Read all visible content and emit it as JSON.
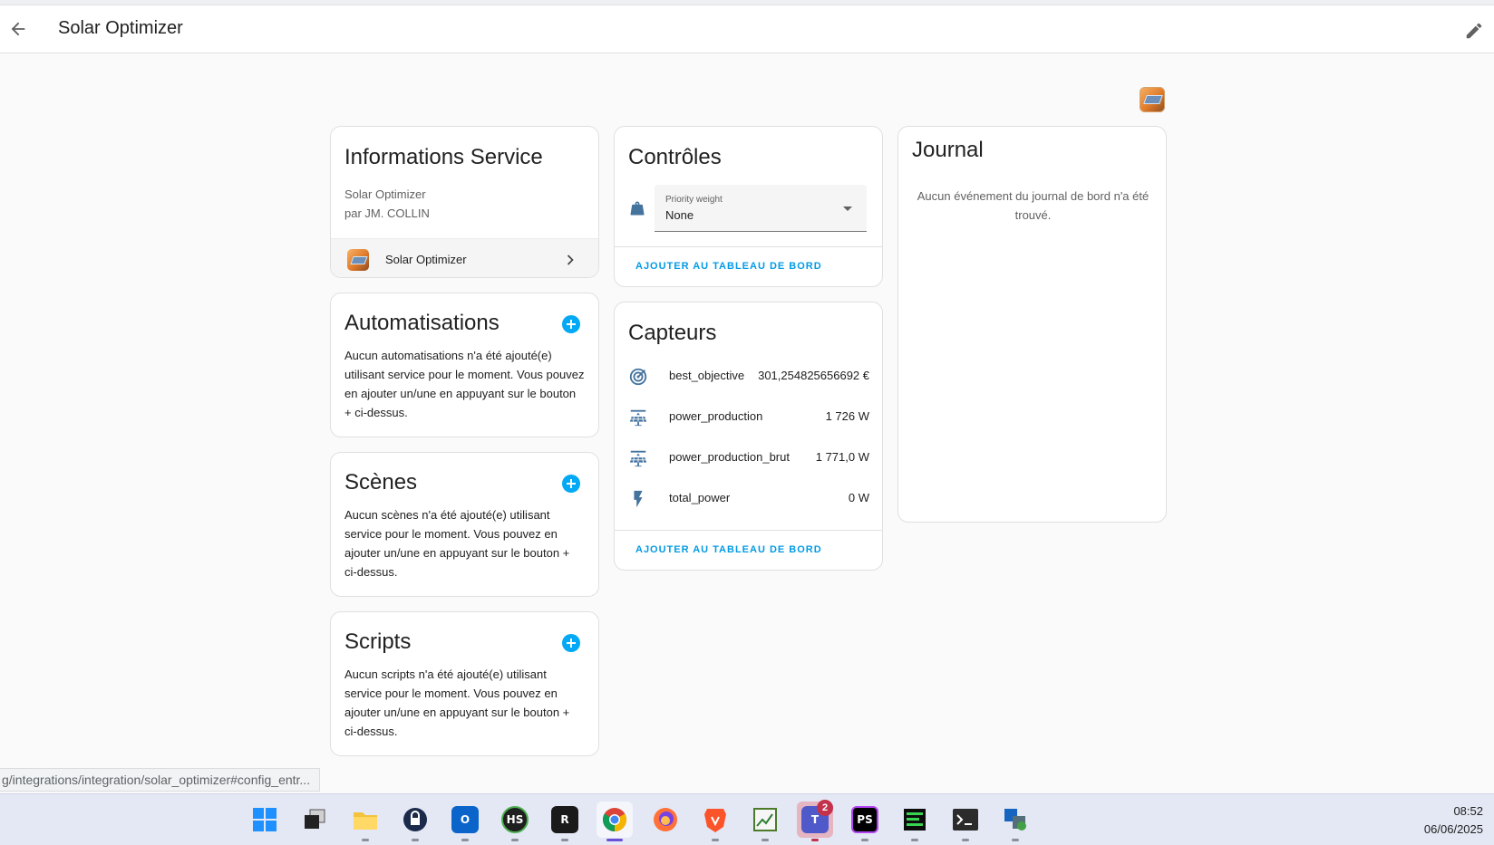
{
  "header": {
    "title": "Solar Optimizer",
    "back_icon": "arrow-left-icon",
    "edit_icon": "pencil-icon"
  },
  "info_card": {
    "title": "Informations Service",
    "service_name": "Solar Optimizer",
    "author": "par JM. COLLIN",
    "device_label": "Solar Optimizer"
  },
  "automations_card": {
    "title": "Automatisations",
    "text": "Aucun automatisations n'a été ajouté(e) utilisant service pour le moment. Vous pouvez en ajouter un/une en appuyant sur le bouton + ci-dessus."
  },
  "scenes_card": {
    "title": "Scènes",
    "text": "Aucun scènes n'a été ajouté(e) utilisant service pour le moment. Vous pouvez en ajouter un/une en appuyant sur le bouton + ci-dessus."
  },
  "scripts_card": {
    "title": "Scripts",
    "text": "Aucun scripts n'a été ajouté(e) utilisant service pour le moment. Vous pouvez en ajouter un/une en appuyant sur le bouton + ci-dessus."
  },
  "controls_card": {
    "title": "Contrôles",
    "select_label": "Priority weight",
    "select_value": "None",
    "action": "AJOUTER AU TABLEAU DE BORD"
  },
  "sensors_card": {
    "title": "Capteurs",
    "sensors": [
      {
        "name": "best_objective",
        "value": "301,254825656692 €",
        "icon": "target-icon"
      },
      {
        "name": "power_production",
        "value": "1 726 W",
        "icon": "solar-panel-icon"
      },
      {
        "name": "power_production_brut",
        "value": "1 771,0 W",
        "icon": "solar-panel-icon"
      },
      {
        "name": "total_power",
        "value": "0 W",
        "icon": "lightning-bolt-icon"
      }
    ],
    "action": "AJOUTER AU TABLEAU DE BORD"
  },
  "journal_card": {
    "title": "Journal",
    "empty_text": "Aucun événement du journal de bord n'a été trouvé."
  },
  "statusbar": {
    "url": "g/integrations/integration/solar_optimizer#config_entr..."
  },
  "taskbar": {
    "time": "08:52",
    "date": "06/06/2025",
    "apps": [
      {
        "name": "windows-start",
        "active": false
      },
      {
        "name": "task-view",
        "active": false
      },
      {
        "name": "file-explorer",
        "active": false
      },
      {
        "name": "password-manager",
        "active": false
      },
      {
        "name": "outlook",
        "active": false
      },
      {
        "name": "hs-app",
        "label": "HS",
        "active": false
      },
      {
        "name": "remote-app",
        "label": "R",
        "active": false
      },
      {
        "name": "chrome",
        "active": true
      },
      {
        "name": "firefox",
        "active": false
      },
      {
        "name": "brave",
        "active": false
      },
      {
        "name": "monitor-app",
        "active": false
      },
      {
        "name": "teams",
        "badge": "2",
        "active": false
      },
      {
        "name": "phpstorm",
        "label": "PS",
        "active": false
      },
      {
        "name": "terminal-green",
        "active": false
      },
      {
        "name": "terminal",
        "active": false
      },
      {
        "name": "network-tool",
        "active": false
      }
    ]
  },
  "colors": {
    "accent": "#03a9f4",
    "link": "#039be5",
    "sensor_icon": "#44739e"
  }
}
